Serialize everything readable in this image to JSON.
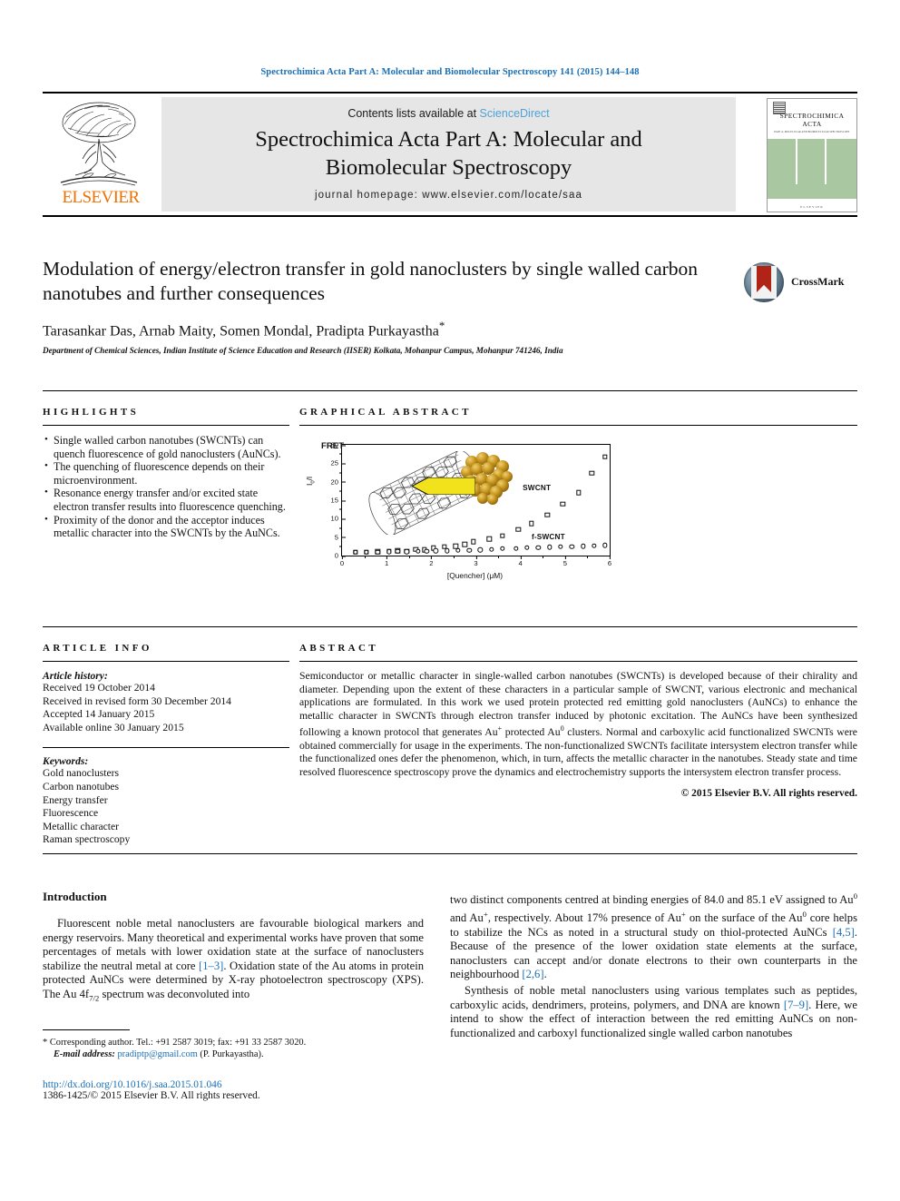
{
  "running_head": "Spectrochimica Acta Part A: Molecular and Biomolecular Spectroscopy 141 (2015) 144–148",
  "masthead": {
    "contents_text": "Contents lists available at",
    "sciencedirect": "ScienceDirect",
    "journal_title_line1": "Spectrochimica Acta Part A: Molecular and",
    "journal_title_line2": "Biomolecular Spectroscopy",
    "homepage": "journal homepage: www.elsevier.com/locate/saa",
    "publisher": "ELSEVIER",
    "cover": {
      "name_line1": "SPECTROCHIMICA",
      "name_line2": "ACTA",
      "subtitle": "PART A: MOLECULAR AND BIOMOLECULAR SPECTROSCOPY",
      "footer": "ELSEVIER"
    }
  },
  "article": {
    "title": "Modulation of energy/electron transfer in gold nanoclusters by single walled carbon nanotubes and further consequences",
    "authors": "Tarasankar Das, Arnab Maity, Somen Mondal, Pradipta Purkayastha",
    "corresponding_marker": "*",
    "affiliation": "Department of Chemical Sciences, Indian Institute of Science Education and Research (IISER) Kolkata, Mohanpur Campus, Mohanpur 741246, India",
    "crossmark_label": "CrossMark"
  },
  "highlights": {
    "heading": "HIGHLIGHTS",
    "items": [
      "Single walled carbon nanotubes (SWCNTs) can quench fluorescence of gold nanoclusters (AuNCs).",
      "The quenching of fluorescence depends on their microenvironment.",
      "Resonance energy transfer and/or excited state electron transfer results into fluorescence quenching.",
      "Proximity of the donor and the acceptor induces metallic character into the SWCNTs by the AuNCs."
    ]
  },
  "graphical_abstract": {
    "heading": "GRAPHICAL ABSTRACT"
  },
  "article_info": {
    "heading": "ARTICLE INFO",
    "history_label": "Article history:",
    "history": [
      "Received 19 October 2014",
      "Received in revised form 30 December 2014",
      "Accepted 14 January 2015",
      "Available online 30 January 2015"
    ],
    "keywords_label": "Keywords:",
    "keywords": [
      "Gold nanoclusters",
      "Carbon nanotubes",
      "Energy transfer",
      "Fluorescence",
      "Metallic character",
      "Raman spectroscopy"
    ]
  },
  "abstract": {
    "heading": "ABSTRACT",
    "text_part1": "Semiconductor or metallic character in single-walled carbon nanotubes (SWCNTs) is developed because of their chirality and diameter. Depending upon the extent of these characters in a particular sample of SWCNT, various electronic and mechanical applications are formulated. In this work we used protein protected red emitting gold nanoclusters (AuNCs) to enhance the metallic character in SWCNTs through electron transfer induced by photonic excitation. The AuNCs have been synthesized following a known protocol that generates Au",
    "sup1": "+",
    "text_part2": " protected Au",
    "sup2": "0",
    "text_part3": " clusters. Normal and carboxylic acid functionalized SWCNTs were obtained commercially for usage in the experiments. The non-functionalized SWCNTs facilitate intersystem electron transfer while the functionalized ones defer the phenomenon, which, in turn, affects the metallic character in the nanotubes. Steady state and time resolved fluorescence spectroscopy prove the dynamics and electrochemistry supports the intersystem electron transfer process.",
    "copyright": "© 2015 Elsevier B.V. All rights reserved."
  },
  "chart_data": {
    "type": "scatter",
    "title": "",
    "xlabel": "[Quencher] (μM)",
    "ylabel": "I0/I",
    "xlim": [
      0,
      6
    ],
    "ylim": [
      0,
      30
    ],
    "xticks": [
      0,
      1,
      2,
      3,
      4,
      5,
      6
    ],
    "yticks": [
      0,
      5,
      10,
      15,
      20,
      25,
      30
    ],
    "grid": false,
    "annotations": [
      "FRET",
      "SWCNT",
      "f-SWCNT"
    ],
    "series": [
      {
        "name": "SWCNT",
        "marker": "square",
        "x": [
          0.3,
          0.55,
          0.8,
          1.05,
          1.25,
          1.45,
          1.65,
          1.85,
          2.05,
          2.3,
          2.55,
          2.75,
          2.95,
          3.3,
          3.6,
          3.95,
          4.25,
          4.6,
          4.95,
          5.3,
          5.6,
          5.9
        ],
        "y": [
          0.95,
          0.95,
          1.05,
          1.25,
          1.35,
          1.15,
          1.75,
          1.6,
          2.05,
          2.45,
          2.55,
          3.05,
          3.75,
          4.55,
          5.35,
          7.1,
          8.7,
          11.0,
          13.9,
          17.0,
          22.4,
          26.7
        ]
      },
      {
        "name": "f-SWCNT",
        "marker": "circle",
        "x": [
          0.3,
          0.55,
          0.8,
          1.05,
          1.25,
          1.45,
          1.7,
          1.9,
          2.1,
          2.35,
          2.6,
          2.85,
          3.1,
          3.35,
          3.6,
          3.9,
          4.15,
          4.4,
          4.65,
          4.9,
          5.15,
          5.4,
          5.65,
          5.9
        ],
        "y": [
          0.9,
          0.95,
          1.0,
          1.1,
          1.15,
          1.1,
          1.2,
          1.25,
          1.35,
          1.3,
          1.4,
          1.45,
          1.55,
          1.7,
          1.85,
          1.95,
          2.1,
          2.2,
          2.25,
          2.35,
          2.45,
          2.5,
          2.6,
          2.75
        ]
      }
    ]
  },
  "body": {
    "introduction_heading": "Introduction",
    "left_p1": "Fluorescent noble metal nanoclusters are favourable biological markers and energy reservoirs. Many theoretical and experimental works have proven that some percentages of metals with lower oxidation state at the surface of nanoclusters stabilize the neutral metal at core",
    "left_ref1": "[1–3]",
    "left_p1b": ". Oxidation state of the Au atoms in protein protected AuNCs were determined by X-ray photoelectron spectroscopy (XPS). The Au 4f",
    "left_sub": "7/2",
    "left_p1c": " spectrum was deconvoluted into",
    "right_p1a": "two distinct components centred at binding energies of 84.0 and 85.1 eV assigned to Au",
    "right_sup1": "0",
    "right_p1b": " and Au",
    "right_sup2": "+",
    "right_p1c": ", respectively. About 17% presence of Au",
    "right_sup3": "+",
    "right_p1d": " on the surface of the Au",
    "right_sup4": "0",
    "right_p1e": " core helps to stabilize the NCs as noted in a structural study on thiol-protected AuNCs",
    "right_ref1": "[4,5]",
    "right_p1f": ". Because of the presence of the lower oxidation state elements at the surface, nanoclusters can accept and/or donate electrons to their own counterparts in the neighbourhood",
    "right_ref2": "[2,6]",
    "right_p1g": ".",
    "right_p2a": "Synthesis of noble metal nanoclusters using various templates such as peptides, carboxylic acids, dendrimers, proteins, polymers, and DNA are known",
    "right_ref3": "[7–9]",
    "right_p2b": ". Here, we intend to show the effect of interaction between the red emitting AuNCs on non-functionalized and carboxyl functionalized single walled carbon nanotubes"
  },
  "footnote": {
    "marker": "*",
    "line1": "Corresponding author. Tel.: +91 2587 3019; fax: +91 33 2587 3020.",
    "email_label": "E-mail address:",
    "email": "pradiptp@gmail.com",
    "email_owner": "(P. Purkayastha).",
    "doi": "http://dx.doi.org/10.1016/j.saa.2015.01.046",
    "issn": "1386-1425/© 2015 Elsevier B.V. All rights reserved."
  },
  "colors": {
    "link_blue": "#1a6fb5",
    "sciencedirect_blue": "#4ea3d8",
    "elsevier_orange": "#ED7102",
    "band_grey": "#e6e6e6",
    "cover_green": "#a9c8a2",
    "fret_yellow": "#f2e21c",
    "gold": "#c9971f"
  }
}
